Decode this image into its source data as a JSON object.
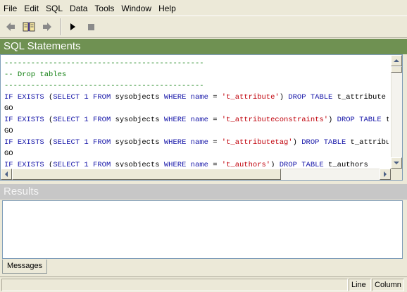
{
  "menu": {
    "file": "File",
    "edit": "Edit",
    "sql": "SQL",
    "data": "Data",
    "tools": "Tools",
    "window": "Window",
    "help": "Help"
  },
  "toolbar": {
    "buttons": [
      "back-arrow-icon",
      "book-icon",
      "forward-arrow-icon",
      "run-triangle-icon",
      "stop-square-icon"
    ]
  },
  "sql_pane": {
    "title": "SQL Statements",
    "lines": [
      {
        "type": "comment",
        "text": "---------------------------------------------"
      },
      {
        "type": "comment",
        "text": "-- Drop tables"
      },
      {
        "type": "comment",
        "text": "---------------------------------------------"
      },
      {
        "type": "stmt",
        "table": "'t_attribute'",
        "tail": " DROP TABLE t_attribute"
      },
      {
        "type": "go",
        "text": "GO"
      },
      {
        "type": "stmt",
        "table": "'t_attributeconstraints'",
        "tail": " DROP TABLE t_attributeconstraints"
      },
      {
        "type": "go",
        "text": "GO"
      },
      {
        "type": "stmt",
        "table": "'t_attributetag'",
        "tail": " DROP TABLE t_attributetag"
      },
      {
        "type": "go",
        "text": "GO"
      },
      {
        "type": "stmt",
        "table": "'t_authors'",
        "tail": " DROP TABLE t_authors"
      }
    ],
    "keywords": {
      "if_exists": "IF EXISTS",
      "select": "SELECT",
      "one": "1",
      "from": "FROM",
      "sysobjects": "sysobjects",
      "where": "WHERE",
      "name": "name",
      "eq": "="
    }
  },
  "results_pane": {
    "title": "Results"
  },
  "tabs": {
    "messages": "Messages"
  },
  "status": {
    "line_label": "Line",
    "column_label": "Column"
  },
  "colors": {
    "sql_header": "#6f9152",
    "results_header": "#c7c7c7",
    "keyword": "#1515a8",
    "string": "#c0000a",
    "comment": "#138013"
  }
}
